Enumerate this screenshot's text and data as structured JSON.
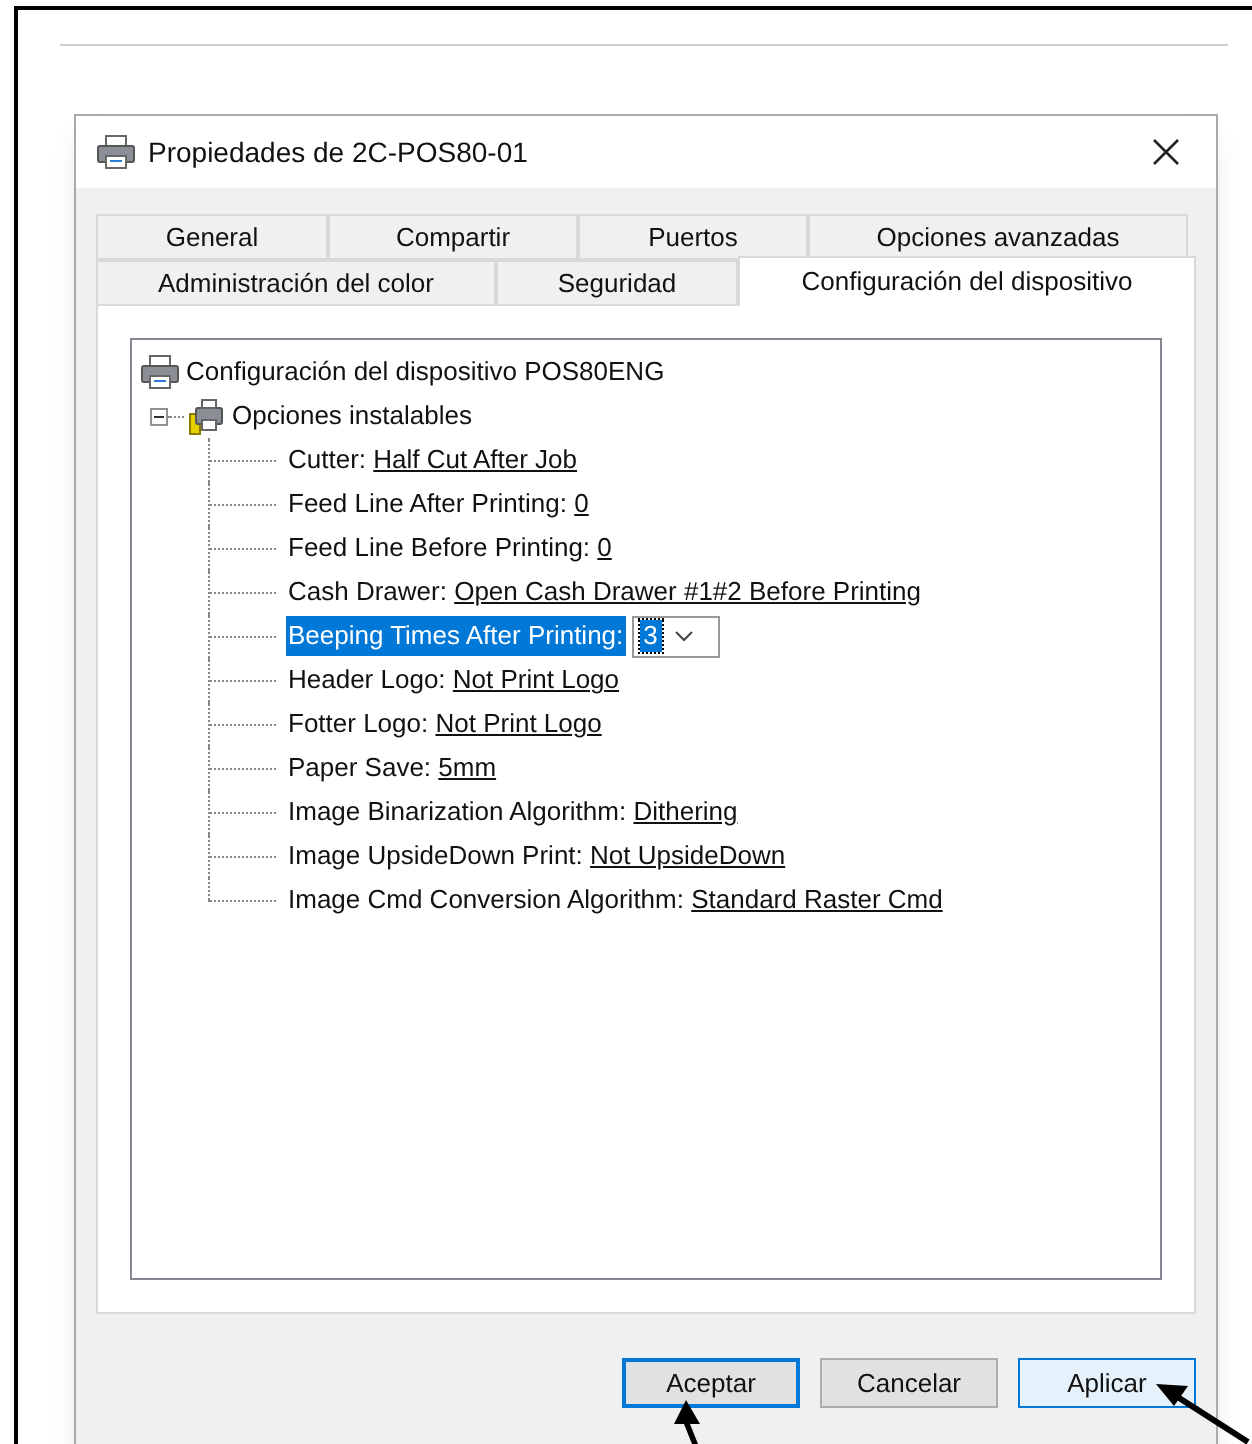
{
  "window": {
    "title": "Propiedades de 2C-POS80-01"
  },
  "tab_rows": [
    [
      {
        "label": "General",
        "selected": false
      },
      {
        "label": "Compartir",
        "selected": false
      },
      {
        "label": "Puertos",
        "selected": false
      },
      {
        "label": "Opciones avanzadas",
        "selected": false
      }
    ],
    [
      {
        "label": "Administración del color",
        "selected": false
      },
      {
        "label": "Seguridad",
        "selected": false
      },
      {
        "label": "Configuración del dispositivo",
        "selected": true
      }
    ]
  ],
  "tree": {
    "label": "Configuración del dispositivo POS80ENG",
    "children": [
      {
        "label": "Opciones instalables",
        "expanded": true,
        "children": [
          {
            "kind": "text",
            "label": "Cutter:",
            "value": "Half Cut After Job",
            "selected": false
          },
          {
            "kind": "text",
            "label": "Feed Line After Printing:",
            "value": "0",
            "selected": false
          },
          {
            "kind": "text",
            "label": "Feed Line Before Printing:",
            "value": "0",
            "selected": false
          },
          {
            "kind": "text",
            "label": "Cash Drawer:",
            "value": "Open Cash Drawer #1#2 Before Printing",
            "selected": false
          },
          {
            "kind": "dropdown",
            "label": "Beeping Times After Printing:",
            "value": "3",
            "selected": true
          },
          {
            "kind": "text",
            "label": "Header Logo:",
            "value": "Not Print Logo",
            "selected": false
          },
          {
            "kind": "text",
            "label": "Fotter Logo:",
            "value": "Not Print Logo",
            "selected": false
          },
          {
            "kind": "text",
            "label": "Paper Save:",
            "value": "5mm",
            "selected": false
          },
          {
            "kind": "text",
            "label": "Image Binarization Algorithm:",
            "value": "Dithering",
            "selected": false
          },
          {
            "kind": "text",
            "label": "Image UpsideDown Print:",
            "value": "Not UpsideDown",
            "selected": false
          },
          {
            "kind": "text",
            "label": "Image Cmd Conversion Algorithm:",
            "value": "Standard Raster Cmd",
            "selected": false
          }
        ]
      }
    ]
  },
  "buttons": [
    {
      "label": "Aceptar",
      "kind": "default"
    },
    {
      "label": "Cancelar",
      "kind": "normal"
    },
    {
      "label": "Aplicar",
      "kind": "hover"
    }
  ]
}
